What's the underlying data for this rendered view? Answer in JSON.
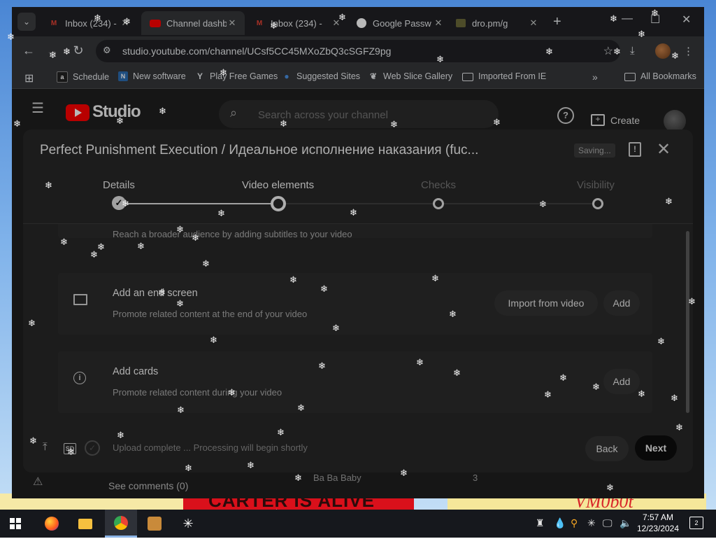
{
  "browser": {
    "tabs": [
      {
        "title": "Inbox (234) - ",
        "favicon": "gmail-icon",
        "active": false
      },
      {
        "title": "Channel dashb",
        "favicon": "youtube-icon",
        "active": true
      },
      {
        "title": "Inbox (234) - ",
        "favicon": "gmail-icon",
        "active": false
      },
      {
        "title": "Google Passw",
        "favicon": "google-password-icon",
        "active": false
      },
      {
        "title": "dro.pm/g",
        "favicon": "dropm-icon",
        "active": false
      }
    ],
    "url": "studio.youtube.com/channel/UCsf5CC45MXoZbQ3cSGFZ9pg",
    "bookmarks": [
      {
        "label": "Schedule",
        "icon": "schedule-icon"
      },
      {
        "label": "New software",
        "icon": "new-software-icon"
      },
      {
        "label": "Play Free Games",
        "icon": "games-icon"
      },
      {
        "label": "Suggested Sites",
        "icon": "suggested-sites-icon"
      },
      {
        "label": "Web Slice Gallery",
        "icon": "web-slice-icon"
      },
      {
        "label": "Imported From IE",
        "icon": "folder-icon"
      }
    ],
    "all_bookmarks": "All Bookmarks"
  },
  "studio": {
    "logo_text": "Studio",
    "search_placeholder": "Search across your channel",
    "create_label": "Create",
    "background": {
      "video_title": "Ba Ba Baby",
      "video_count": "3",
      "see_comments": "See comments (0)"
    }
  },
  "dialog": {
    "title": "Perfect Punishment Execution / Идеальное исполнение наказания (fuc...",
    "saving": "Saving...",
    "steps": [
      {
        "label": "Details",
        "state": "done"
      },
      {
        "label": "Video elements",
        "state": "current"
      },
      {
        "label": "Checks",
        "state": "upcoming"
      },
      {
        "label": "Visibility",
        "state": "upcoming"
      }
    ],
    "subtitles_sub": "Reach a broader audience by adding subtitles to your video",
    "end_screen": {
      "title": "Add an end screen",
      "subtitle": "Promote related content at the end of your video",
      "import_label": "Import from video",
      "add_label": "Add"
    },
    "cards": {
      "title": "Add cards",
      "subtitle": "Promote related content during your video",
      "add_label": "Add"
    },
    "footer": {
      "quality": "SD",
      "status": "Upload complete ... Processing will begin shortly",
      "back_label": "Back",
      "next_label": "Next"
    }
  },
  "desktop": {
    "banner_text": "CARTER IS ALIVE",
    "signature": "VM0b0t"
  },
  "taskbar": {
    "time": "7:57 AM",
    "date": "12/23/2024",
    "notifications": "2"
  },
  "colors": {
    "accent_red": "#ff0000",
    "dialog_bg": "#282828",
    "next_button": "#0d0d0d"
  }
}
